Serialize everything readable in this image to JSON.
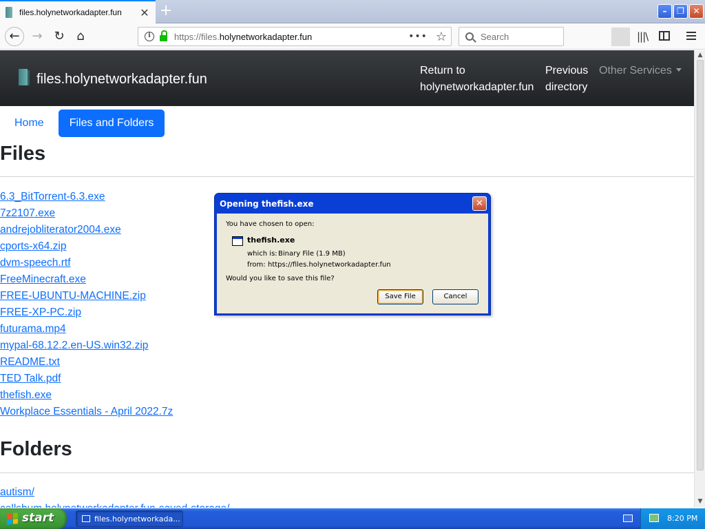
{
  "browser": {
    "tab_title": "files.holynetworkadapter.fun",
    "url_plain": "https://files.",
    "url_domain": "holynetworkadapter.fun",
    "search_placeholder": "Search"
  },
  "site": {
    "brand": "files.holynetworkadapter.fun",
    "nav": {
      "return_line1": "Return to",
      "return_line2": "holynetworkadapter.fun",
      "previous_line1": "Previous",
      "previous_line2": "directory",
      "other_services": "Other Services"
    },
    "pills": [
      "Home",
      "Files and Folders"
    ],
    "files_heading": "Files",
    "files": [
      "6.3_BitTorrent-6.3.exe",
      "7z2107.exe",
      "andrejobliterator2004.exe",
      "cports-x64.zip",
      "dvm-speech.rtf",
      "FreeMinecraft.exe",
      "FREE-UBUNTU-MACHINE.zip",
      "FREE-XP-PC.zip",
      "futurama.mp4",
      "mypal-68.12.2.en-US.win32.zip",
      "README.txt",
      "TED Talk.pdf",
      "thefish.exe",
      "Workplace Essentials - April 2022.7z"
    ],
    "folders_heading": "Folders",
    "folders": [
      "autism/",
      "cellsbum.holynetworkadapter.fun-saved-storage/"
    ]
  },
  "dialog": {
    "title": "Opening thefish.exe",
    "intro": "You have chosen to open:",
    "filename": "thefish.exe",
    "which_is_label": "which is:",
    "which_is_value": "Binary File (1.9 MB)",
    "from_label": "from:",
    "from_value": "https://files.holynetworkadapter.fun",
    "question": "Would you like to save this file?",
    "save_label": "Save File",
    "cancel_label": "Cancel"
  },
  "taskbar": {
    "start_label": "start",
    "task_label": "files.holynetworkada...",
    "clock": "8:20 PM"
  },
  "colors": {
    "link": "#0d6efd",
    "header_bg": "#2b2e31",
    "xp_blue": "#0a3fd6",
    "xp_taskbar": "#245edb",
    "start_green": "#3c9a35"
  }
}
